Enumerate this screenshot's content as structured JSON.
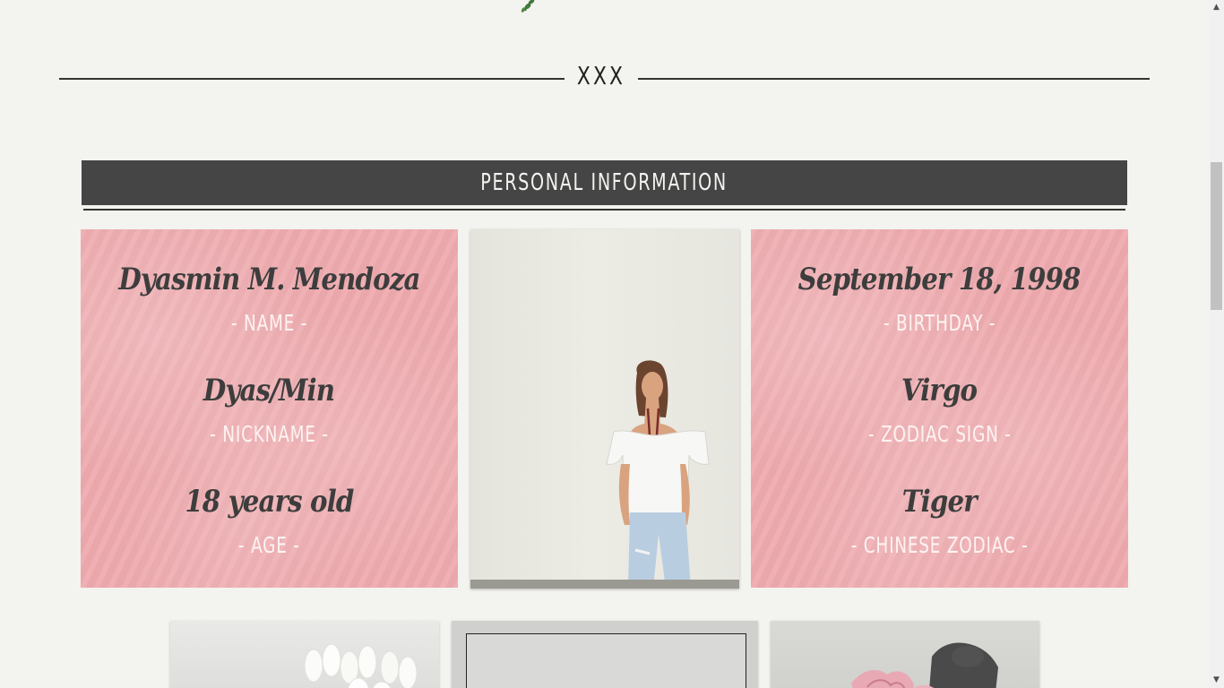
{
  "divider": {
    "text": "XXX"
  },
  "section": {
    "title": "PERSONAL INFORMATION"
  },
  "left_card": {
    "fields": [
      {
        "value": "Dyasmin M. Mendoza",
        "label": "- NAME -"
      },
      {
        "value": "Dyas/Min",
        "label": "- NICKNAME -"
      },
      {
        "value": "18 years old",
        "label": "- AGE -"
      }
    ]
  },
  "right_card": {
    "fields": [
      {
        "value": "September 18, 1998",
        "label": "- BIRTHDAY -"
      },
      {
        "value": "Virgo",
        "label": "- ZODIAC SIGN -"
      },
      {
        "value": "Tiger",
        "label": "- CHINESE ZODIAC -"
      }
    ]
  },
  "colors": {
    "background": "#f3f3ef",
    "band": "#454545",
    "card_pink": "#eeaaae",
    "value_text": "#3d3d3d",
    "label_text": "#fdf3f2",
    "sprig_green": "#3f7a3a"
  },
  "icons": {
    "sprig": "leaf-sprig-icon",
    "scroll_up": "arrow-up-icon",
    "scroll_down": "arrow-down-icon"
  },
  "scrollbar": {
    "up": "▲",
    "down": "▼"
  }
}
